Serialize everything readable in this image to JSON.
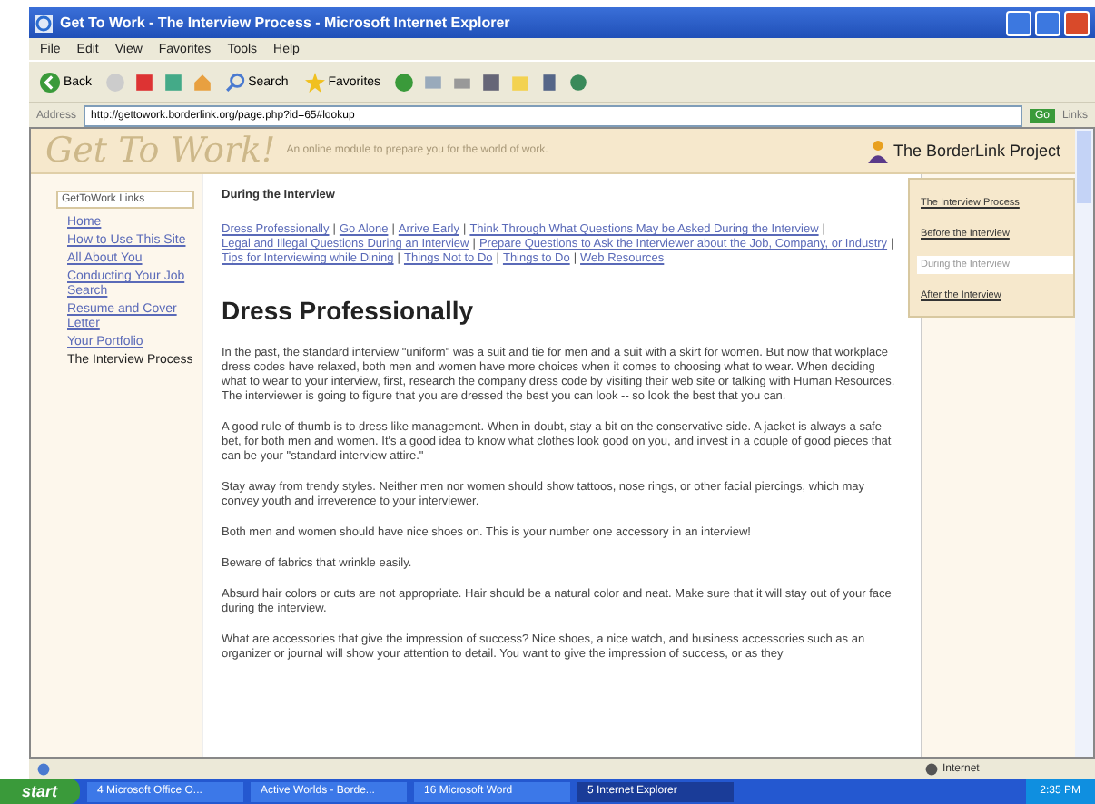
{
  "window": {
    "title": "Get To Work - The Interview Process - Microsoft Internet Explorer"
  },
  "menu": [
    "File",
    "Edit",
    "View",
    "Favorites",
    "Tools",
    "Help"
  ],
  "toolbar": {
    "back": "Back",
    "search": "Search",
    "favorites": "Favorites"
  },
  "address": {
    "label": "Address",
    "url": "http://gettowork.borderlink.org/page.php?id=65#lookup",
    "go": "Go",
    "links": "Links"
  },
  "site": {
    "logo": "Get To Work!",
    "tagline": "An online module to prepare you for the world of work.",
    "project": "The BorderLink Project"
  },
  "sidebar": {
    "title": "GetToWork Links",
    "items": [
      {
        "label": "Home",
        "selected": false
      },
      {
        "label": "How to Use This Site",
        "selected": false
      },
      {
        "label": "All About You",
        "selected": false
      },
      {
        "label": "Conducting Your Job Search",
        "selected": false
      },
      {
        "label": "Resume and Cover Letter",
        "selected": false
      },
      {
        "label": "Your Portfolio",
        "selected": false
      },
      {
        "label": "The Interview Process",
        "selected": true
      }
    ]
  },
  "section_title": "During the Interview",
  "topic_separator": "|",
  "topic_links": [
    "Dress Professionally",
    "Go Alone",
    "Arrive Early",
    "Think Through What Questions May be Asked During the Interview",
    "Legal and Illegal Questions During an Interview",
    "Prepare Questions to Ask the Interviewer about the Job, Company, or Industry",
    "Tips for Interviewing while Dining",
    "Things Not to Do",
    "Things to Do",
    "Web Resources"
  ],
  "heading": "Dress Professionally",
  "paragraphs": [
    "In the past, the standard interview \"uniform\" was a suit and tie for men and a suit with a skirt for women. But now that workplace dress codes have relaxed, both men and women have more choices when it comes to choosing what to wear. When deciding what to wear to your interview, first, research the company dress code by visiting their web site or talking with Human Resources. The interviewer is going to figure that you are dressed the best you can look -- so look the best that you can.",
    "A good rule of thumb is to dress like management. When in doubt, stay a bit on the conservative side. A jacket is always a safe bet, for both men and women. It's a good idea to know what clothes look good on you, and invest in a couple of good pieces that can be your \"standard interview attire.\"",
    "Stay away from trendy styles. Neither men nor women should show tattoos, nose rings, or other facial piercings, which may convey youth and irreverence to your interviewer.",
    "Both men and women should have nice shoes on. This is your number one accessory in an interview!",
    "Beware of fabrics that wrinkle easily.",
    "Absurd hair colors or cuts are not appropriate. Hair should be a natural color and neat. Make sure that it will stay out of your face during the interview.",
    "What are accessories that give the impression of success? Nice shoes, a nice watch, and business accessories such as an organizer or journal will show your attention to detail. You want to give the impression of success, or as they"
  ],
  "subnav": [
    {
      "label": "The Interview Process",
      "selected": false
    },
    {
      "label": "Before the Interview",
      "selected": false
    },
    {
      "label": "During the Interview",
      "selected": true
    },
    {
      "label": "After the Interview",
      "selected": false
    }
  ],
  "status_bar": {
    "zone": "Internet"
  },
  "taskbar": {
    "start": "start",
    "tasks": [
      {
        "label": "4 Microsoft Office O...",
        "selected": false
      },
      {
        "label": "Active Worlds - Borde...",
        "selected": false
      },
      {
        "label": "16 Microsoft Word",
        "selected": false
      },
      {
        "label": "5 Internet Explorer",
        "selected": true
      }
    ],
    "clock": "2:35 PM"
  }
}
